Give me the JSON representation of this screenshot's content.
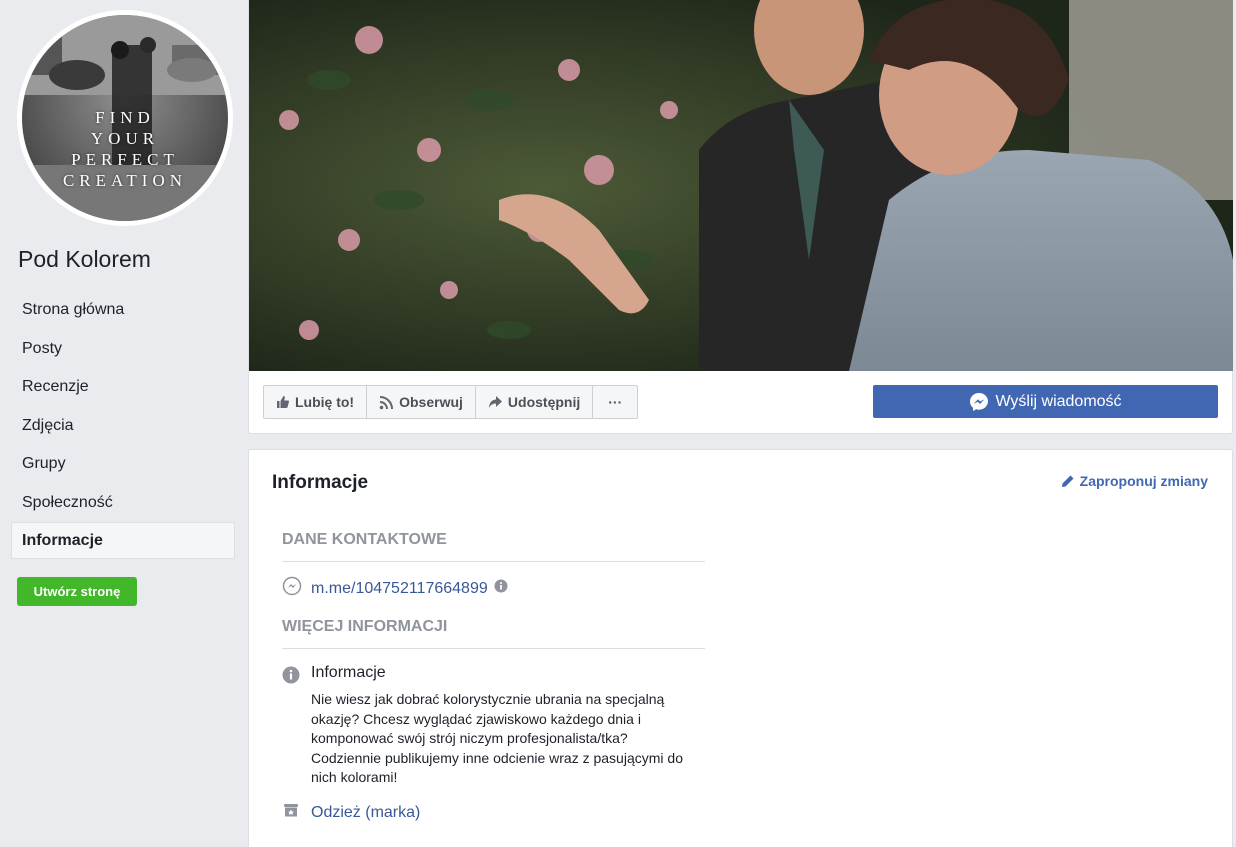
{
  "sidebar": {
    "avatar_text": [
      "FIND",
      "YOUR",
      "PERFECT",
      "CREATION"
    ],
    "page_name": "Pod Kolorem",
    "nav": [
      {
        "label": "Strona główna",
        "active": false
      },
      {
        "label": "Posty",
        "active": false
      },
      {
        "label": "Recenzje",
        "active": false
      },
      {
        "label": "Zdjęcia",
        "active": false
      },
      {
        "label": "Grupy",
        "active": false
      },
      {
        "label": "Społeczność",
        "active": false
      },
      {
        "label": "Informacje",
        "active": true
      }
    ],
    "create_page_label": "Utwórz stronę"
  },
  "actions": {
    "like_label": "Lubię to!",
    "follow_label": "Obserwuj",
    "share_label": "Udostępnij",
    "more_label": "···",
    "message_label": "Wyślij wiadomość"
  },
  "info": {
    "title": "Informacje",
    "suggest_label": "Zaproponuj zmiany",
    "contact_heading": "DANE KONTAKTOWE",
    "messenger_link": "m.me/104752117664899",
    "more_heading": "WIĘCEJ INFORMACJI",
    "about_label": "Informacje",
    "about_text": "Nie wiesz jak dobrać kolorystycznie ubrania na specjalną okazję? Chcesz wyglądać zjawiskowo każdego dnia i komponować swój strój niczym profesjonalista/tka? Codziennie publikujemy inne odcienie wraz z pasującymi do nich kolorami!",
    "category_label": "Odzież (marka)"
  },
  "colors": {
    "brand_blue": "#4267b2",
    "link_blue": "#385898",
    "green": "#42b72a",
    "background": "#e9ebee"
  },
  "icons": {
    "like": "thumbs-up-icon",
    "follow": "rss-icon",
    "share": "share-arrow-icon",
    "messenger": "messenger-icon",
    "pencil": "pencil-icon",
    "info": "info-circle-icon",
    "category": "store-icon"
  }
}
